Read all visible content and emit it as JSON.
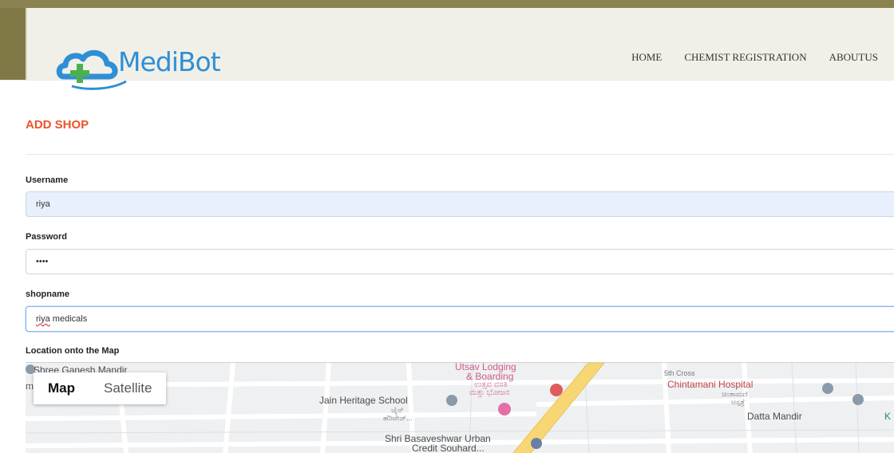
{
  "header": {
    "logo_text": "MediBot",
    "nav": [
      "HOME",
      "CHEMIST REGISTRATION",
      "ABOUTUS"
    ]
  },
  "form": {
    "title": "ADD SHOP",
    "username": {
      "label": "Username",
      "value": "riya"
    },
    "password": {
      "label": "Password",
      "value": "••••"
    },
    "shopname": {
      "label": "shopname",
      "value_word1": "riya",
      "value_rest": " medicals"
    },
    "location_label": "Location onto the Map"
  },
  "map": {
    "toggle": {
      "map": "Map",
      "satellite": "Satellite"
    },
    "labels": {
      "ganesh": "Shree Ganesh Mandir",
      "utsav1": "Utsav Lodging",
      "utsav2": "& Boarding",
      "utsav3": "ಉತ್ಸವ ವಸತಿ",
      "utsav4": "ಮತ್ತು ಭೋಜನ",
      "jain": "Jain Heritage School",
      "jain_kn1": "ಜೈನ್",
      "jain_kn2": "ಹೆರಿಟೇಜ್...",
      "shri1": "Shri Basaveshwar Urban",
      "shri2": "Credit Souhard...",
      "cross": "5th Cross",
      "chintamani": "Chintamani Hospital",
      "chintamani_kn1": "ಚಿಂತಾಮಣಿ",
      "chintamani_kn2": "ಆಸ್ಪತ್ರೆ",
      "datta": "Datta Mandir",
      "edge_k": "K",
      "left_clip": "mple"
    }
  },
  "colors": {
    "accent": "#f0512a",
    "logo_blue": "#2f8fd6",
    "logo_green": "#4cb050"
  }
}
